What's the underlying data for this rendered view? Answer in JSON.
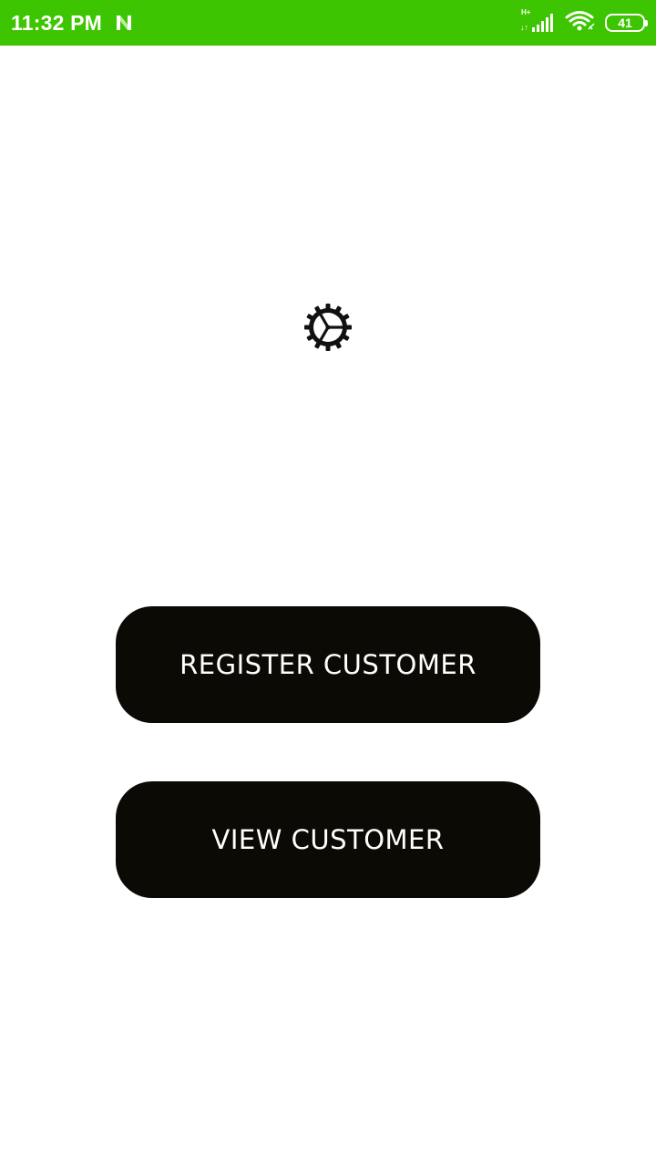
{
  "status_bar": {
    "time": "11:32 PM",
    "network_type": "H+",
    "data_arrows": "↓↑",
    "battery_level": "41",
    "background_color": "#3cc500",
    "icons": [
      "n-notification-icon",
      "signal-icon",
      "wifi-icon",
      "battery-icon"
    ]
  },
  "main": {
    "center_icon": "gear-icon",
    "buttons": {
      "register_label": "REGISTER CUSTOMER",
      "view_label": "VIEW CUSTOMER",
      "background_color": "#0b0a05",
      "text_color": "#ffffff"
    }
  }
}
